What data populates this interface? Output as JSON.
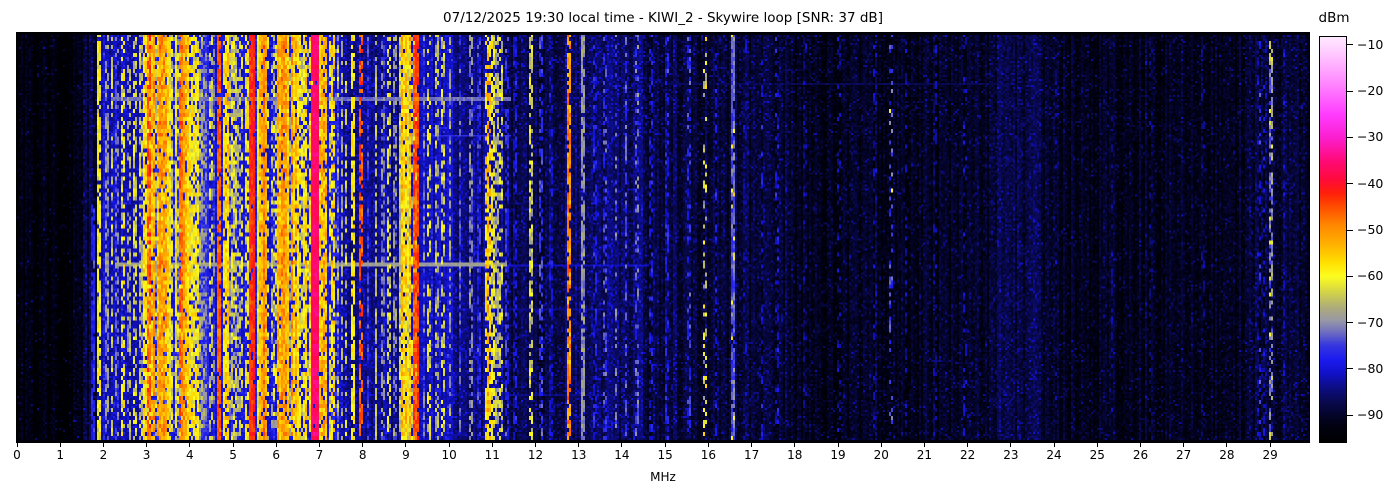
{
  "figure": {
    "background": "#ffffff",
    "frame_color": "#000000"
  },
  "chart_data": {
    "type": "heatmap",
    "subtype": "radio-spectrogram-waterfall",
    "title": "07/12/2025 19:30 local time - KIWI_2 - Skywire loop [SNR: 37 dB]",
    "xlabel": "MHz",
    "x_range": [
      0,
      29.9
    ],
    "x_ticks": [
      0,
      1,
      2,
      3,
      4,
      5,
      6,
      7,
      8,
      9,
      10,
      11,
      12,
      13,
      14,
      15,
      16,
      17,
      18,
      19,
      20,
      21,
      22,
      23,
      24,
      25,
      26,
      27,
      28,
      29
    ],
    "x_tick_labels": [
      "0",
      "1",
      "2",
      "3",
      "4",
      "5",
      "6",
      "7",
      "8",
      "9",
      "10",
      "11",
      "12",
      "13",
      "14",
      "15",
      "16",
      "17",
      "18",
      "19",
      "20",
      "21",
      "22",
      "23",
      "24",
      "25",
      "26",
      "27",
      "28",
      "29"
    ],
    "grid": false,
    "colorbar": {
      "label": "dBm",
      "min": -95.8,
      "max": -8.3,
      "ticks": [
        {
          "v": -10,
          "label": "−10"
        },
        {
          "v": -20,
          "label": "−20"
        },
        {
          "v": -30,
          "label": "−30"
        },
        {
          "v": -40,
          "label": "−40"
        },
        {
          "v": -50,
          "label": "−50"
        },
        {
          "v": -60,
          "label": "−60"
        },
        {
          "v": -70,
          "label": "−70"
        },
        {
          "v": -80,
          "label": "−80"
        },
        {
          "v": -90,
          "label": "−90"
        }
      ],
      "colormap": [
        [
          -95.8,
          "#000000"
        ],
        [
          -92.5,
          "#010110"
        ],
        [
          -90.0,
          "#04042a"
        ],
        [
          -87.0,
          "#090950"
        ],
        [
          -84.0,
          "#0d0d85"
        ],
        [
          -81.0,
          "#1111c8"
        ],
        [
          -78.0,
          "#1b1bef"
        ],
        [
          -75.0,
          "#3535e0"
        ],
        [
          -72.0,
          "#6f6fc0"
        ],
        [
          -69.5,
          "#9898a5"
        ],
        [
          -67.0,
          "#aaa97e"
        ],
        [
          -63.0,
          "#d8d842"
        ],
        [
          -60.0,
          "#fdfd20"
        ],
        [
          -57.0,
          "#ffdf00"
        ],
        [
          -53.0,
          "#ffb000"
        ],
        [
          -49.0,
          "#ff8800"
        ],
        [
          -45.0,
          "#ff4d00"
        ],
        [
          -42.0,
          "#ff1f0a"
        ],
        [
          -39.0,
          "#ff0a3c"
        ],
        [
          -35.0,
          "#ff0a78"
        ],
        [
          -30.0,
          "#fb1fd0"
        ],
        [
          -25.0,
          "#ff3cff"
        ],
        [
          -18.0,
          "#ff8aff"
        ],
        [
          -12.0,
          "#ffc8ff"
        ],
        [
          -8.3,
          "#ffe9ff"
        ]
      ]
    },
    "noise_floor_segments_mhz_dbm": [
      [
        0.0,
        1.55,
        -93.5,
        0.06,
        8
      ],
      [
        1.55,
        1.85,
        -89,
        0.15,
        7
      ],
      [
        1.85,
        3.1,
        -81.5,
        0.3,
        5
      ],
      [
        3.1,
        4.4,
        -78.5,
        0.35,
        5
      ],
      [
        4.4,
        7.5,
        -80,
        0.35,
        5
      ],
      [
        7.5,
        8.9,
        -84,
        0.3,
        6
      ],
      [
        8.9,
        10.1,
        -82.5,
        0.3,
        5
      ],
      [
        10.1,
        11.25,
        -84.5,
        0.3,
        6
      ],
      [
        11.25,
        12.65,
        -88.5,
        0.22,
        7
      ],
      [
        12.65,
        14.6,
        -86.5,
        0.25,
        7
      ],
      [
        14.6,
        15.3,
        -88.5,
        0.2,
        7
      ],
      [
        15.3,
        18.0,
        -89.5,
        0.2,
        7
      ],
      [
        18.0,
        22.5,
        -91,
        0.15,
        7
      ],
      [
        22.5,
        23.7,
        -88.5,
        0.25,
        6
      ],
      [
        23.7,
        28.4,
        -91,
        0.13,
        7
      ],
      [
        28.4,
        29.9,
        -90,
        0.2,
        7
      ]
    ],
    "signals_mhz_dbm": [
      [
        1.72,
        1.76,
        -77,
        0.8,
        3,
        0.42,
        1
      ],
      [
        1.88,
        1.93,
        -60,
        0.85,
        4
      ],
      [
        2.05,
        2.09,
        -70,
        0.6,
        4
      ],
      [
        2.18,
        2.22,
        -66,
        0.55,
        4
      ],
      [
        2.28,
        2.32,
        -73,
        0.5,
        4
      ],
      [
        2.42,
        2.47,
        -62,
        0.5,
        5
      ],
      [
        2.56,
        2.6,
        -68,
        0.5,
        4
      ],
      [
        2.7,
        2.74,
        -63,
        0.55,
        5
      ],
      [
        2.83,
        2.88,
        -66,
        0.6,
        5
      ],
      [
        2.96,
        3.04,
        -58,
        0.85,
        5
      ],
      [
        3.04,
        3.1,
        -47,
        0.8,
        5
      ],
      [
        3.1,
        3.55,
        -54,
        0.92,
        5
      ],
      [
        3.3,
        3.36,
        -50,
        0.75,
        5
      ],
      [
        3.55,
        3.68,
        -63,
        0.7,
        6
      ],
      [
        3.7,
        3.98,
        -53,
        0.92,
        5
      ],
      [
        3.79,
        3.84,
        -47,
        0.8,
        4
      ],
      [
        3.98,
        4.08,
        -59,
        0.8,
        5
      ],
      [
        4.12,
        4.19,
        -59,
        0.8,
        5
      ],
      [
        4.25,
        4.28,
        -67,
        0.6,
        4
      ],
      [
        4.35,
        4.38,
        -70,
        0.55,
        4
      ],
      [
        4.45,
        4.49,
        -64,
        0.5,
        5
      ],
      [
        4.55,
        4.58,
        -69,
        0.5,
        4
      ],
      [
        4.65,
        4.7,
        -46,
        0.88,
        3
      ],
      [
        4.77,
        4.88,
        -57,
        0.8,
        5
      ],
      [
        4.92,
        5.08,
        -63,
        0.7,
        6
      ],
      [
        5.13,
        5.16,
        -67,
        0.5,
        4
      ],
      [
        5.2,
        5.23,
        -62,
        0.5,
        5
      ],
      [
        5.29,
        5.33,
        -60,
        0.65,
        5
      ],
      [
        5.41,
        5.47,
        -42,
        0.96,
        3
      ],
      [
        5.6,
        5.82,
        -51,
        0.93,
        4
      ],
      [
        5.88,
        5.99,
        -65,
        0.5,
        6
      ],
      [
        6.02,
        6.25,
        -52,
        0.93,
        5
      ],
      [
        6.25,
        6.48,
        -54,
        0.88,
        5
      ],
      [
        6.52,
        6.58,
        -62,
        0.6,
        5
      ],
      [
        6.62,
        6.84,
        -56,
        0.85,
        5
      ],
      [
        6.85,
        6.95,
        -37,
        0.99,
        2
      ],
      [
        6.98,
        7.17,
        -55,
        0.88,
        5
      ],
      [
        7.25,
        7.42,
        -59,
        0.65,
        6
      ],
      [
        7.5,
        7.53,
        -68,
        0.5,
        4
      ],
      [
        7.6,
        7.63,
        -64,
        0.45,
        5
      ],
      [
        7.77,
        7.81,
        -60,
        0.7,
        4
      ],
      [
        7.95,
        8.0,
        -46,
        0.55,
        4
      ],
      [
        8.1,
        8.13,
        -75,
        0.6,
        4
      ],
      [
        8.29,
        8.32,
        -67,
        0.75,
        3
      ],
      [
        8.45,
        8.48,
        -70,
        0.55,
        4
      ],
      [
        8.6,
        8.64,
        -63,
        0.5,
        5
      ],
      [
        8.73,
        8.76,
        -71,
        0.5,
        4
      ],
      [
        8.86,
        9.06,
        -57,
        0.9,
        5
      ],
      [
        9.06,
        9.23,
        -54,
        0.92,
        5
      ],
      [
        9.21,
        9.3,
        -45,
        0.9,
        4
      ],
      [
        9.4,
        9.43,
        -72,
        0.6,
        5
      ],
      [
        9.53,
        9.56,
        -63,
        0.5,
        5
      ],
      [
        9.7,
        9.73,
        -67,
        0.5,
        5
      ],
      [
        9.85,
        9.88,
        -64,
        0.5,
        5
      ],
      [
        10.0,
        10.04,
        -68,
        0.6,
        4
      ],
      [
        10.23,
        10.26,
        -74,
        0.6,
        4
      ],
      [
        10.5,
        10.53,
        -71,
        0.5,
        4
      ],
      [
        10.68,
        10.71,
        -76,
        0.5,
        4
      ],
      [
        10.84,
        10.88,
        -57,
        0.6,
        6
      ],
      [
        10.92,
        10.96,
        -55,
        0.55,
        6
      ],
      [
        11.0,
        11.04,
        -62,
        0.7,
        5
      ],
      [
        11.1,
        11.14,
        -66,
        0.7,
        4
      ],
      [
        11.19,
        11.22,
        -64,
        0.5,
        5
      ],
      [
        11.33,
        11.36,
        -77,
        0.6,
        4
      ],
      [
        11.51,
        11.54,
        -80,
        0.5,
        4
      ],
      [
        11.86,
        11.9,
        -65,
        0.6,
        5
      ],
      [
        12.1,
        12.13,
        -77,
        0.5,
        4
      ],
      [
        12.33,
        12.36,
        -80,
        0.45,
        4
      ],
      [
        12.76,
        12.81,
        -49,
        0.8,
        5
      ],
      [
        13.09,
        13.13,
        -68,
        0.8,
        3
      ],
      [
        13.37,
        13.4,
        -77,
        0.5,
        4
      ],
      [
        13.6,
        13.63,
        -75,
        0.45,
        4
      ],
      [
        13.84,
        13.87,
        -73,
        0.4,
        5
      ],
      [
        14.08,
        14.11,
        -76,
        0.5,
        4
      ],
      [
        14.32,
        14.36,
        -74,
        0.4,
        5
      ],
      [
        14.66,
        14.69,
        -79,
        0.4,
        4
      ],
      [
        15.03,
        15.06,
        -78,
        0.45,
        4
      ],
      [
        15.53,
        15.56,
        -77,
        0.4,
        4
      ],
      [
        15.9,
        15.94,
        -64,
        0.3,
        7
      ],
      [
        16.16,
        16.19,
        -80,
        0.4,
        4
      ],
      [
        16.54,
        16.59,
        -73,
        0.9,
        3
      ],
      [
        16.55,
        16.58,
        -60,
        0.06,
        4
      ],
      [
        16.84,
        16.87,
        -83,
        0.4,
        4
      ],
      [
        17.22,
        17.25,
        -81,
        0.4,
        4
      ],
      [
        17.58,
        17.61,
        -79,
        0.35,
        5
      ],
      [
        18.23,
        18.26,
        -84,
        0.3,
        4
      ],
      [
        19.02,
        19.05,
        -82,
        0.3,
        4
      ],
      [
        19.83,
        19.86,
        -84,
        0.3,
        4
      ],
      [
        20.2,
        20.24,
        -76,
        0.3,
        5
      ],
      [
        20.21,
        20.23,
        -60,
        0.025,
        3
      ],
      [
        20.56,
        20.59,
        -83,
        0.35,
        4
      ],
      [
        21.22,
        21.25,
        -85,
        0.3,
        4
      ],
      [
        21.93,
        21.96,
        -84,
        0.3,
        4
      ],
      [
        24.03,
        24.06,
        -86,
        0.3,
        4
      ],
      [
        25.33,
        25.36,
        -85,
        0.3,
        4
      ],
      [
        26.23,
        26.26,
        -86,
        0.3,
        4
      ],
      [
        27.43,
        27.46,
        -85,
        0.3,
        4
      ],
      [
        28.74,
        28.9,
        -80,
        0.35,
        5
      ],
      [
        28.99,
        29.05,
        -71,
        0.55,
        4
      ],
      [
        29.0,
        29.04,
        -64,
        0.12,
        4
      ],
      [
        29.3,
        29.34,
        -82,
        0.3,
        4
      ]
    ],
    "burst_streaks": [
      {
        "y": 0.155,
        "h": 2,
        "a": 2.2,
        "b": 11.4,
        "lv": -72
      },
      {
        "y": 0.25,
        "h": 1,
        "a": 9.4,
        "b": 11.4,
        "lv": -76
      },
      {
        "y": 0.562,
        "h": 2,
        "a": 2.3,
        "b": 11.3,
        "lv": -68.5
      },
      {
        "y": 0.565,
        "h": 1,
        "a": 11.3,
        "b": 14.6,
        "lv": -81
      },
      {
        "y": 0.122,
        "h": 1,
        "a": 14.6,
        "b": 23.0,
        "lv": -87
      },
      {
        "y": 0.672,
        "h": 1,
        "a": 9.6,
        "b": 14.0,
        "lv": -83.5
      },
      {
        "y": 0.885,
        "h": 1,
        "a": 10.0,
        "b": 13.6,
        "lv": -84
      }
    ],
    "render": {
      "cols": 646,
      "rows": 205,
      "seed": 20250712
    }
  }
}
